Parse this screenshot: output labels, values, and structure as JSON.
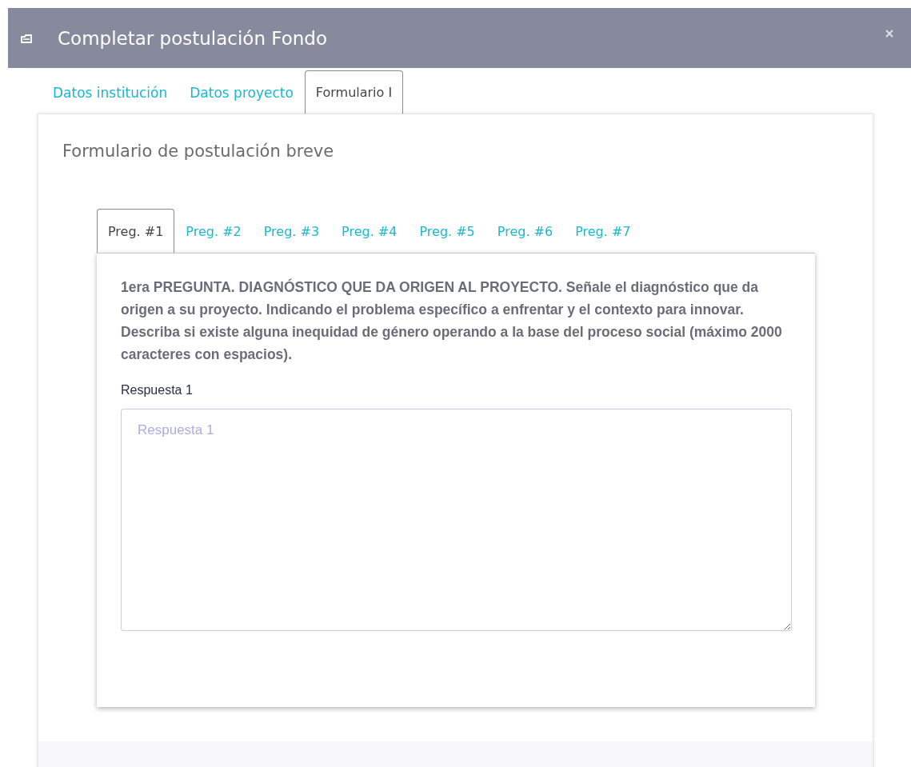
{
  "window": {
    "title": "Completar postulación Fondo"
  },
  "tabs": [
    {
      "label": "Datos institución",
      "selected": false
    },
    {
      "label": "Datos proyecto",
      "selected": false
    },
    {
      "label": "Formulario I",
      "selected": true
    }
  ],
  "form": {
    "title": "Formulario de postulación breve",
    "question_tabs": [
      {
        "label": "Preg. #1",
        "selected": true
      },
      {
        "label": "Preg. #2",
        "selected": false
      },
      {
        "label": "Preg. #3",
        "selected": false
      },
      {
        "label": "Preg. #4",
        "selected": false
      },
      {
        "label": "Preg. #5",
        "selected": false
      },
      {
        "label": "Preg. #6",
        "selected": false
      },
      {
        "label": "Preg. #7",
        "selected": false
      }
    ],
    "question": "1era PREGUNTA. DIAGNÓSTICO QUE DA ORIGEN AL PROYECTO. Señale el diagnóstico que da origen a su proyecto. Indicando el problema específico a enfrentar y el contexto para innovar. Describa si existe alguna inequidad de género operando a la base del proceso social (máximo 2000 caracteres con espacios).",
    "answer_label": "Respuesta 1",
    "answer": {
      "placeholder": "Respuesta 1"
    }
  }
}
